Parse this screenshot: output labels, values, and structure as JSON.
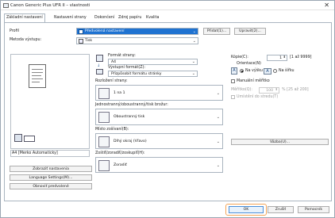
{
  "window": {
    "title": "Canon Generic Plus UFR II – vlastnosti",
    "close_glyph": "✕"
  },
  "tabs": [
    "Základní nastavení",
    "Nastavení strany",
    "Dokončení",
    "Zdroj papíru",
    "Kvalita"
  ],
  "profile": {
    "label": "Profil",
    "value": "Předvolená nastavení",
    "add_button": "Přidat(1)...",
    "edit_button": "Upravit(2)..."
  },
  "output_method": {
    "label": "Metoda výstupu:",
    "value": "Tisk"
  },
  "paper": {
    "page_format_label": "Formát strany:",
    "page_format_value": "A4",
    "output_format_label": "Výstupní formát(Z):",
    "output_format_value": "Přizpůsobit formátu stránky"
  },
  "copies": {
    "label": "Kópie(C):",
    "value": "1",
    "range": "[1 až 9999]"
  },
  "orientation": {
    "label": "Orientace(N)",
    "portrait": "Na výšku",
    "landscape": "Na šířku",
    "selected": "portrait"
  },
  "layout": {
    "label": "Rozložení strany:",
    "value": "1 na 1"
  },
  "manual_scaling": {
    "label": "Manuální měřítko",
    "scale_label": "Měřítko(Q):",
    "scale_value": "100",
    "scale_range": "% [25 až 200]",
    "stamp_label": "Umístění do stredu(T)"
  },
  "duplex": {
    "label": "Jednostranný/oboustranný/tisk brožur:",
    "value": "Oboustranný tisk"
  },
  "binding": {
    "label": "Místo zošívaní(B):",
    "value": "Dlhý okraj (Vľavo)",
    "margin_button": "Väzba(U)..."
  },
  "finishing": {
    "label": "Zoštiť/zoradiť/zoskupiť(H):",
    "value": "Zoradiť"
  },
  "preview_caption": "A4 [Merko Automaticky]",
  "left_buttons": [
    "Zobraziť nastavenia",
    "Language Settings(M)...",
    "Obnoviť predvolené"
  ],
  "footer": {
    "ok": "OK",
    "cancel": "Zrušiť",
    "help": "Pomocník"
  }
}
